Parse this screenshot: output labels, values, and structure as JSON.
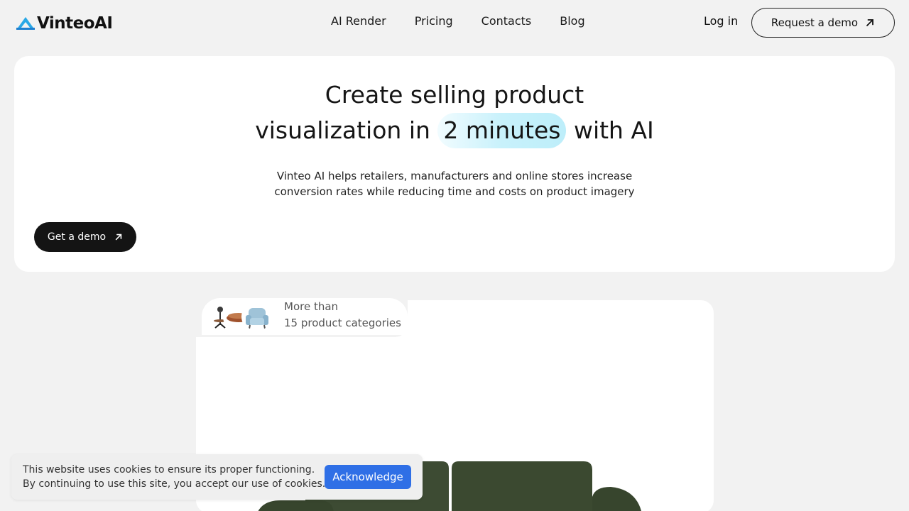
{
  "header": {
    "logo_text": "VinteoAI",
    "nav": [
      "AI Render",
      "Pricing",
      "Contacts",
      "Blog"
    ],
    "login_label": "Log in",
    "request_demo_label": "Request a demo"
  },
  "hero": {
    "title_line1": "Create selling product",
    "title_line2_before": "visualization in ",
    "title_highlight": "2 minutes",
    "title_line2_after": " with AI",
    "subtitle_line1": "Vinteo AI helps retailers, manufacturers and online stores increase",
    "subtitle_line2": "conversion rates while reducing time and costs on product imagery",
    "cta_label": "Get a demo"
  },
  "showcase": {
    "categories_line1": "More than",
    "categories_line2": "15 product categories"
  },
  "cookie": {
    "line1": "This website uses cookies to ensure its proper functioning.",
    "line2": "By continuing to use this site, you accept our use of cookies.",
    "button_label": "Acknowledge"
  },
  "colors": {
    "accent_blue": "#2f6fe6",
    "logo_blue": "#29a8e6",
    "dark_button": "#141414",
    "sofa_green": "#3b4a30"
  }
}
